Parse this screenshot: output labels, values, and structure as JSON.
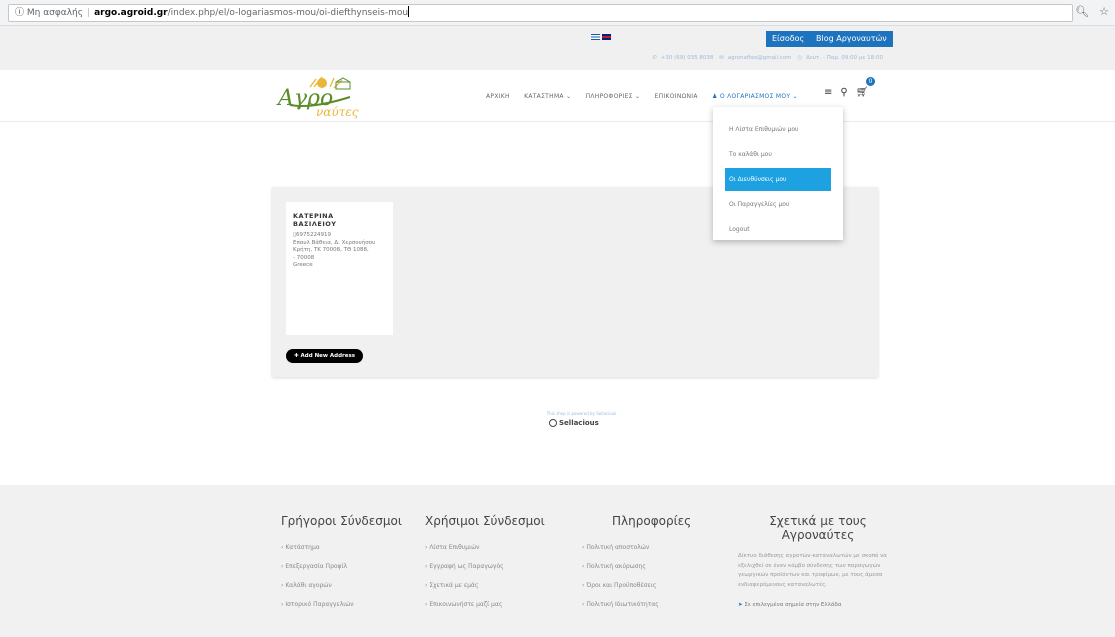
{
  "browser": {
    "security": "Μη ασφαλής",
    "domain": "argo.agroid.gr",
    "path": "/index.php/el/o-logariasmos-mou/oi-diefthynseis-mou",
    "icons": [
      "zoom-icon",
      "star-icon"
    ]
  },
  "topbar": {
    "login_label": "Είσοδος",
    "blog_label": "Blog Αργοναυτών",
    "phone": "+30 (69) 035 8038",
    "email": "agronaftes@gmail.com",
    "hours": "Δευτ. - Παρ. 09:00 με 18:00"
  },
  "header": {
    "logo_text": "Αγροναύτες",
    "nav": [
      {
        "label": "ΑΡΧΙΚΗ"
      },
      {
        "label": "ΚΑΤΑΣΤΗΜΑ ⌄"
      },
      {
        "label": "ΠΛΗΡΟΦΟΡΙΕΣ ⌄"
      },
      {
        "label": "ΕΠΙΚΟΙΝΩΝΙΑ"
      },
      {
        "label": "Ο ΛΟΓΑΡΙΑΣΜΟΣ ΜΟΥ ⌄"
      }
    ],
    "cart_count": "0"
  },
  "dropdown": {
    "items": [
      {
        "label": "Η Λίστα Επιθυμιών μου"
      },
      {
        "label": "Το καλάθι μου"
      },
      {
        "label": "Οι Διευθύνσεις μου"
      },
      {
        "label": "Οι Παραγγελίες μου"
      },
      {
        "label": "Logout"
      }
    ]
  },
  "address": {
    "name": "ΚΑΤΕΡΙΝΑ ΒΑΣΙΛΕΙΟΥ",
    "phone": "6975224919",
    "lines": [
      "Επαυλ Βάθεια, Δ. Χερσονήσου",
      "Κρήτη, ΤΚ 70008, ΤΘ 1088,",
      "- 70008",
      "Greece"
    ],
    "add_button_label": "Add New Address"
  },
  "powered": {
    "text": "This shop is powered by Sellacious",
    "brand": "Sellacious"
  },
  "footer": {
    "columns": [
      {
        "title": "Γρήγοροι Σύνδεσμοι",
        "links": [
          "Κατάστημα",
          "Επεξεργασία Προφίλ",
          "Καλάθι αγορών",
          "Ιστορικό Παραγγελιών"
        ]
      },
      {
        "title": "Χρήσιμοι Σύνδεσμοι",
        "links": [
          "Λίστα Επιθυμιών",
          "Εγγραφή ως Παραγωγός",
          "Σχετικά με εμάς",
          "Επικοινωνήστε μαζί μας"
        ]
      },
      {
        "title": "Πληροφορίες",
        "links": [
          "Πολιτική αποστολών",
          "Πολιτική ακύρωσης",
          "Όροι και Προϋποθέσεις",
          "Πολιτική Ιδιωτικότητας"
        ]
      }
    ],
    "about_title": "Σχετικά με τους Αγροναύτες",
    "about_text": "Δίκτυο διάθεσης αγροτών-καταναλωτών με σκοπό να εξελιχθεί σε έναν κόμβο σύνδεσης των παραγωγών γεωργικών προϊόντων και τροφίμων, με τους άμεσα ενδιαφερόμενους καταναλωτές.",
    "location_text": "Σε επιλεγμένα σημεία στην Ελλάδα"
  },
  "colors": {
    "primary": "#1e73be",
    "dropdown_active": "#1ea1e1",
    "logo_green": "#5a8c2a",
    "logo_yellow": "#e8b73a"
  }
}
